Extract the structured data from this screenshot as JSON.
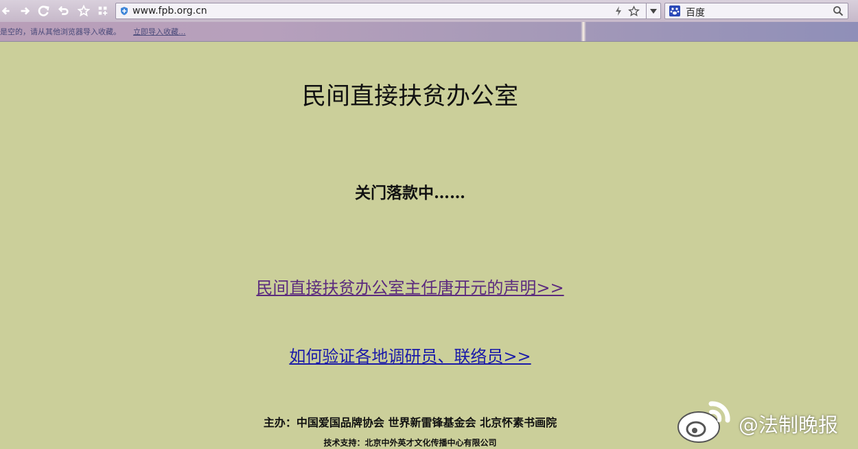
{
  "browser": {
    "url": "www.fpb.org.cn",
    "search_engine": "百度",
    "bookmarks_notice": "是空的，请从其他浏览器导入收藏。",
    "bookmarks_import_link": "立即导入收藏..."
  },
  "page": {
    "title": "民间直接扶贫办公室",
    "subtitle": "关门落款中……",
    "statement_link": "民间直接扶贫办公室主任唐开元的声明>>",
    "verify_link": "如何验证各地调研员、联络员>>",
    "sponsors": "主办：中国爱国品牌协会 世界新雷锋基金会 北京怀素书画院",
    "tech_support": "技术支持：北京中外英才文化传播中心有限公司"
  },
  "watermark": {
    "text": "@法制晚报",
    "icon": "weibo-icon"
  },
  "colors": {
    "page_bg": "#cbcf9a",
    "visited_link": "#5b2a7e",
    "link": "#1a1aa8"
  }
}
